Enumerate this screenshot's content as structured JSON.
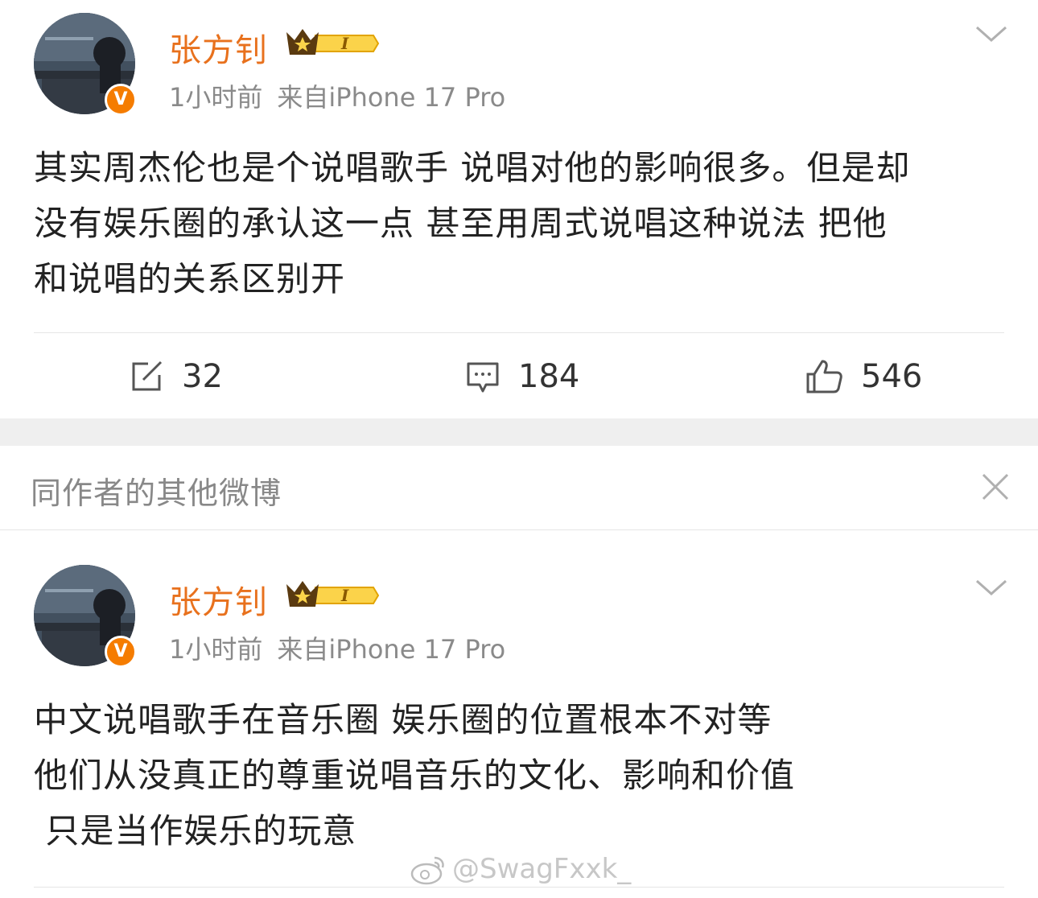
{
  "posts": [
    {
      "username": "张方钊",
      "level_badge": "I",
      "verified_badge": "V",
      "time": "1小时前",
      "source": "来自iPhone 17 Pro",
      "content_lines": [
        "其实周杰伦也是个说唱歌手 说唱对他的影响很多。但是却",
        "没有娱乐圈的承认这一点 甚至用周式说唱这种说法 把他",
        "和说唱的关系区别开"
      ],
      "reposts": "32",
      "comments": "184",
      "likes": "546"
    },
    {
      "username": "张方钊",
      "level_badge": "I",
      "verified_badge": "V",
      "time": "1小时前",
      "source": "来自iPhone 17 Pro",
      "content_lines": [
        "中文说唱歌手在音乐圈 娱乐圈的位置根本不对等",
        "他们从没真正的尊重说唱音乐的文化、影响和价值",
        " 只是当作娱乐的玩意"
      ]
    }
  ],
  "section": {
    "title": "同作者的其他微博"
  },
  "watermark": "@SwagFxxk_",
  "colors": {
    "username": "#e8711d",
    "meta": "#8a8a8a",
    "verified": "#f57c00",
    "crown": "#f5b400"
  },
  "icons": [
    "chevron-down-icon",
    "repost-icon",
    "comment-icon",
    "like-icon",
    "close-icon",
    "weibo-logo-icon",
    "crown-icon"
  ]
}
